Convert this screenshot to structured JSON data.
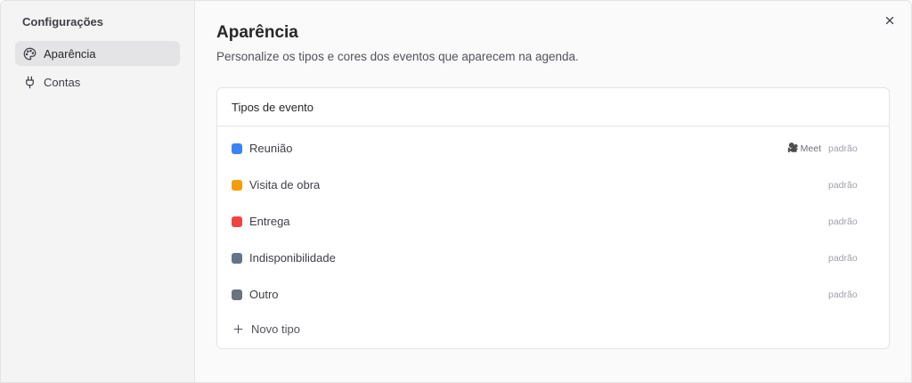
{
  "sidebar": {
    "title": "Configurações",
    "items": [
      {
        "label": "Aparência",
        "icon": "palette-icon",
        "active": true
      },
      {
        "label": "Contas",
        "icon": "plug-icon",
        "active": false
      }
    ]
  },
  "main": {
    "title": "Aparência",
    "subtitle": "Personalize os tipos e cores dos eventos que aparecem na agenda.",
    "close_icon": "close-icon"
  },
  "event_types": {
    "header": "Tipos de evento",
    "items": [
      {
        "name": "Reunião",
        "color": "#3b82f6",
        "meet": "Meet",
        "meet_icon": "video-camera-icon",
        "badge": "padrão"
      },
      {
        "name": "Visita de obra",
        "color": "#f59e0b",
        "badge": "padrão"
      },
      {
        "name": "Entrega",
        "color": "#ef4444",
        "badge": "padrão"
      },
      {
        "name": "Indisponibilidade",
        "color": "#64748b",
        "badge": "padrão"
      },
      {
        "name": "Outro",
        "color": "#6b7280",
        "badge": "padrão"
      }
    ],
    "add_label": "Novo tipo"
  }
}
